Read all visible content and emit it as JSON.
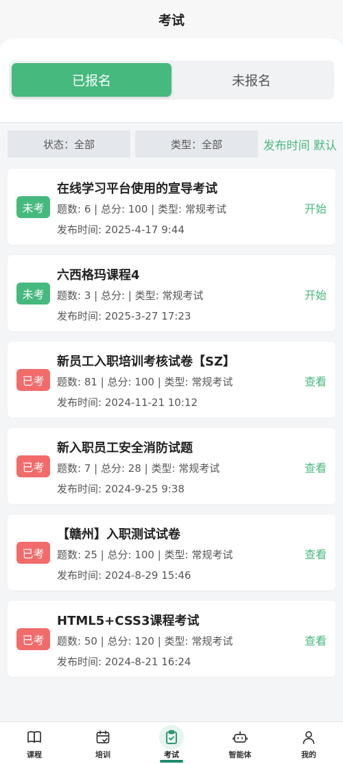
{
  "header": {
    "title": "考试"
  },
  "tabs": [
    {
      "label": "已报名",
      "active": true
    },
    {
      "label": "未报名",
      "active": false
    }
  ],
  "filters": {
    "status": "状态：全部",
    "type": "类型：全部",
    "sort": "发布时间 默认"
  },
  "exams": [
    {
      "badge": "未考",
      "state": "pending",
      "title": "在线学习平台使用的宣导考试",
      "meta": "题数: 6 | 总分: 100 | 类型: 常规考试",
      "time": "发布时间: 2025-4-17 9:44",
      "action": "开始"
    },
    {
      "badge": "未考",
      "state": "pending",
      "title": "六西格玛课程4",
      "meta": "题数: 3 | 总分: | 类型: 常规考试",
      "time": "发布时间: 2025-3-27 17:23",
      "action": "开始"
    },
    {
      "badge": "已考",
      "state": "done",
      "title": "新员工入职培训考核试卷【SZ】",
      "meta": "题数: 81 | 总分: 100 | 类型: 常规考试",
      "time": "发布时间: 2024-11-21 10:12",
      "action": "查看"
    },
    {
      "badge": "已考",
      "state": "done",
      "title": "新入职员工安全消防试题",
      "meta": "题数: 7 | 总分: 28 | 类型: 常规考试",
      "time": "发布时间: 2024-9-25 9:38",
      "action": "查看"
    },
    {
      "badge": "已考",
      "state": "done",
      "title": "【赣州】入职测试试卷",
      "meta": "题数: 25 | 总分: 100 | 类型: 常规考试",
      "time": "发布时间: 2024-8-29 15:46",
      "action": "查看"
    },
    {
      "badge": "已考",
      "state": "done",
      "title": "HTML5+CSS3课程考试",
      "meta": "题数: 50 | 总分: 120 | 类型: 常规考试",
      "time": "发布时间: 2024-8-21 16:24",
      "action": "查看"
    }
  ],
  "nav": [
    {
      "label": "课程",
      "icon": "book-icon",
      "active": false
    },
    {
      "label": "培训",
      "icon": "calendar-check-icon",
      "active": false
    },
    {
      "label": "考试",
      "icon": "clipboard-check-icon",
      "active": true
    },
    {
      "label": "智能体",
      "icon": "robot-icon",
      "active": false
    },
    {
      "label": "我的",
      "icon": "user-icon",
      "active": false
    }
  ],
  "colors": {
    "accent": "#46b97e",
    "done": "#f26b6b",
    "nav_active": "#1f8a6a"
  }
}
